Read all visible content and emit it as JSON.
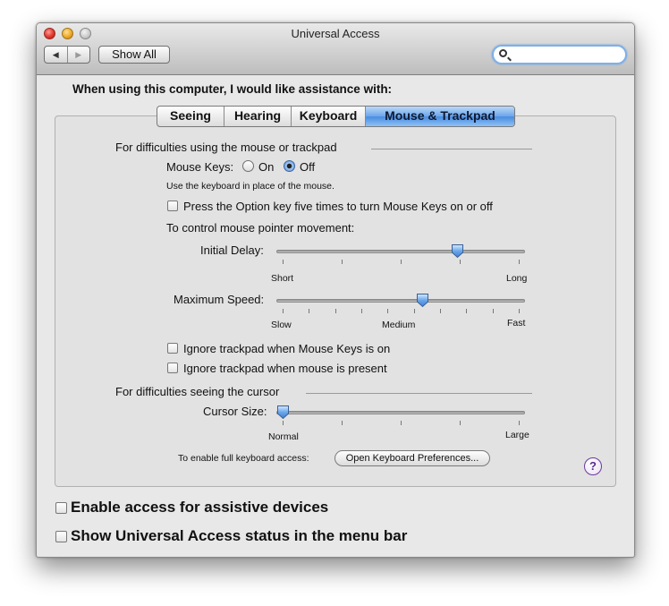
{
  "window": {
    "title": "Universal Access"
  },
  "toolbar": {
    "back_icon": "◀",
    "forward_icon": "▶",
    "show_all_label": "Show All",
    "search_value": "",
    "search_placeholder": ""
  },
  "heading": "When using this computer, I would like assistance with:",
  "tabs": [
    {
      "label": "Seeing",
      "active": false
    },
    {
      "label": "Hearing",
      "active": false
    },
    {
      "label": "Keyboard",
      "active": false
    },
    {
      "label": "Mouse & Trackpad",
      "active": true
    }
  ],
  "mouse_section": {
    "title": "For difficulties using the mouse or trackpad",
    "mouse_keys_label": "Mouse Keys:",
    "on_label": "On",
    "off_label": "Off",
    "mouse_keys_value": "Off",
    "mouse_keys_desc": "Use the keyboard in place of the mouse.",
    "option_key_label": "Press the Option key five times to turn Mouse Keys on or off",
    "option_key_checked": false,
    "control_label": "To control mouse pointer movement:",
    "initial_delay": {
      "label": "Initial Delay:",
      "min_label": "Short",
      "max_label": "Long",
      "value_fraction": 0.74
    },
    "max_speed": {
      "label": "Maximum Speed:",
      "min_label": "Slow",
      "mid_label": "Medium",
      "max_label": "Fast",
      "value_fraction": 0.59
    },
    "ignore_mousekeys_label": "Ignore trackpad when Mouse Keys is on",
    "ignore_mousekeys_checked": false,
    "ignore_mouse_label": "Ignore trackpad when mouse is present",
    "ignore_mouse_checked": false
  },
  "cursor_section": {
    "title": "For difficulties seeing the cursor",
    "cursor_size": {
      "label": "Cursor Size:",
      "min_label": "Normal",
      "max_label": "Large",
      "value_fraction": 0.0
    }
  },
  "keyboard_access": {
    "label": "To enable full keyboard access:",
    "button_label": "Open Keyboard Preferences..."
  },
  "help_label": "?",
  "footer": {
    "assistive_label": "Enable access for assistive devices",
    "assistive_checked": false,
    "status_label": "Show Universal Access status in the menu bar",
    "status_checked": false
  }
}
